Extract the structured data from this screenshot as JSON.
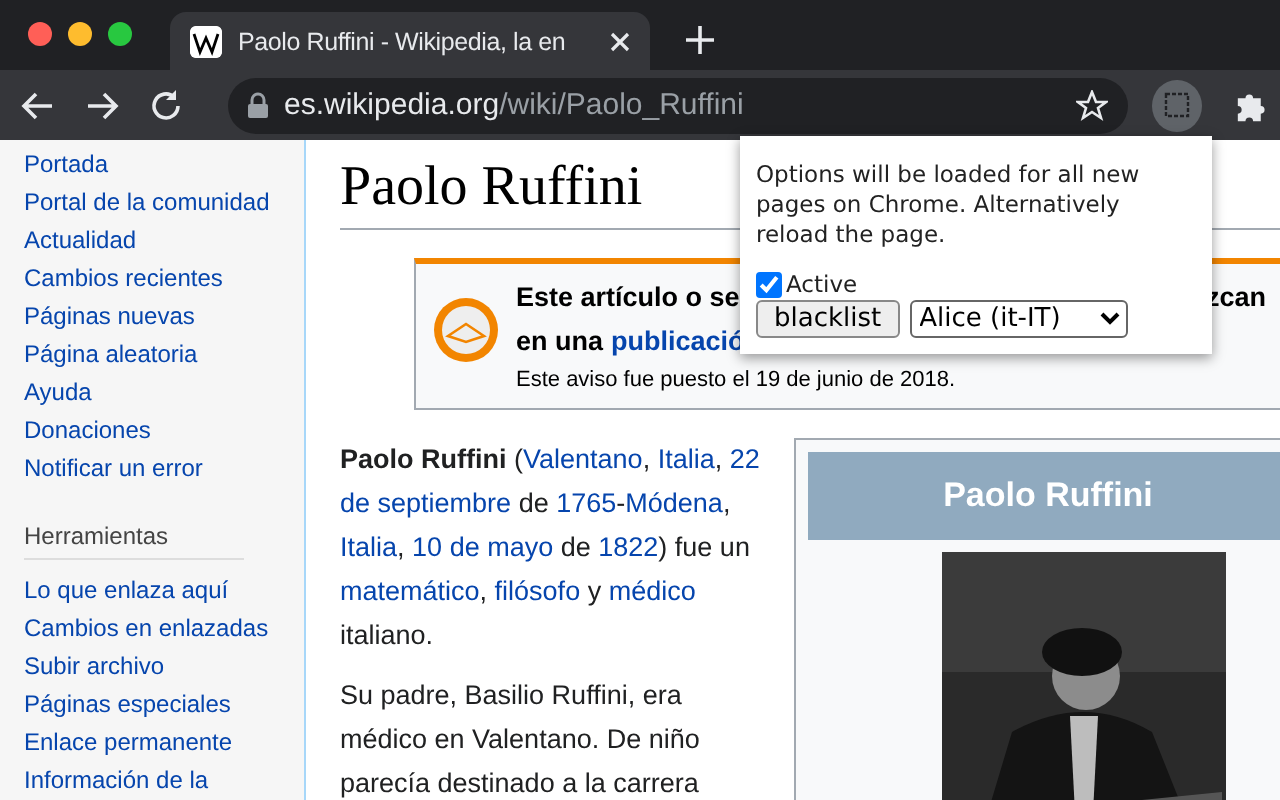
{
  "browser": {
    "tab": {
      "title": "Paolo Ruffini - Wikipedia, la en",
      "selected": true
    },
    "url": {
      "host": "es.wikipedia.org",
      "path": "/wiki/Paolo_Ruffini"
    }
  },
  "sidebar": {
    "items": [
      "Portada",
      "Portal de la comunidad",
      "Actualidad",
      "Cambios recientes",
      "Páginas nuevas",
      "Página aleatoria",
      "Ayuda",
      "Donaciones",
      "Notificar un error"
    ],
    "section": {
      "title": "Herramientas",
      "items": [
        "Lo que enlaza aquí",
        "Cambios en enlazadas",
        "Subir archivo",
        "Páginas especiales",
        "Enlace permanente",
        "Información de la"
      ]
    }
  },
  "article": {
    "title": "Paolo Ruffini",
    "notice": {
      "line_1_start": "Este artículo o se",
      "line_1_end": "zcan",
      "line_2_start": "en una",
      "line_2_link": "publicació",
      "footnote": "Este aviso fue puesto el 19 de junio de 2018."
    },
    "paragraphs": [
      [
        {
          "text": "Paolo Ruffini",
          "kind": "bold"
        },
        {
          "text": " (",
          "kind": "plain"
        },
        {
          "text": "Valentano",
          "kind": "link"
        },
        {
          "text": ", ",
          "kind": "plain"
        },
        {
          "text": "Italia",
          "kind": "link"
        },
        {
          "text": ", ",
          "kind": "plain"
        },
        {
          "text": "22",
          "kind": "link"
        },
        {
          "kind": "space"
        },
        {
          "text": "de septiembre",
          "kind": "link"
        },
        {
          "text": " de ",
          "kind": "plain"
        },
        {
          "text": "1765",
          "kind": "link"
        },
        {
          "text": "-",
          "kind": "plain"
        },
        {
          "text": "Módena",
          "kind": "link"
        },
        {
          "text": ", ",
          "kind": "plain"
        },
        {
          "text": "Italia",
          "kind": "link"
        },
        {
          "text": ", ",
          "kind": "plain"
        },
        {
          "text": "10 de mayo",
          "kind": "link"
        },
        {
          "text": " de ",
          "kind": "plain"
        },
        {
          "text": "1822",
          "kind": "link"
        },
        {
          "text": ") fue un ",
          "kind": "plain"
        },
        {
          "text": "matemático",
          "kind": "link"
        },
        {
          "text": ", ",
          "kind": "plain"
        },
        {
          "text": "filósofo",
          "kind": "link"
        },
        {
          "text": " y ",
          "kind": "plain"
        },
        {
          "text": "médico",
          "kind": "link"
        },
        {
          "text": " italiano.",
          "kind": "plain"
        }
      ],
      [
        {
          "text": "Su padre, Basilio Ruffini, era médico en Valentano. De niño parecía destinado a la carrera",
          "kind": "plain"
        }
      ]
    ],
    "infobox": {
      "title": "Paolo Ruffini"
    }
  },
  "popup": {
    "message": "Options will be loaded for all new pages on Chrome. Alternatively reload the page.",
    "active": {
      "label": "Active",
      "checked": true
    },
    "button": "blacklist",
    "voice": {
      "value": "Alice (it-IT)"
    }
  }
}
